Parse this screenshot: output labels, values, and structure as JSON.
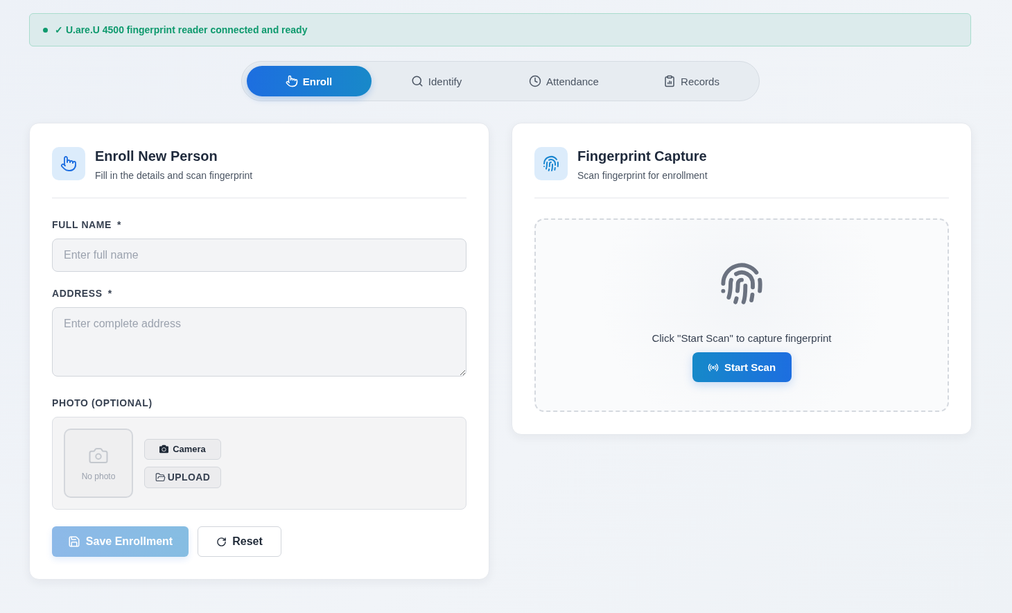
{
  "status_banner": {
    "kind": "success",
    "text": "✓ U.are.U 4500 fingerprint reader connected and ready"
  },
  "tabs": [
    {
      "label": "Enroll",
      "selected": true
    },
    {
      "label": "Identify",
      "selected": false
    },
    {
      "label": "Attendance",
      "selected": false
    },
    {
      "label": "Records",
      "selected": false
    }
  ],
  "enroll_panel": {
    "title": "Enroll New Person",
    "subtitle": "Fill in the details and scan fingerprint",
    "fields": [
      {
        "kind": "input",
        "label": "FULL NAME",
        "required_mark": "*",
        "placeholder": "Enter full name"
      },
      {
        "kind": "textarea",
        "label": "ADDRESS",
        "required_mark": "*",
        "placeholder": "Enter complete address"
      }
    ],
    "photo": {
      "label": "PHOTO (OPTIONAL)",
      "empty_text": "No photo",
      "buttons": [
        "Camera",
        "UPLOAD"
      ]
    },
    "actions": [
      {
        "kind": "primary",
        "label": "Save Enrollment",
        "disabled": true
      },
      {
        "kind": "secondary",
        "label": "Reset",
        "disabled": false
      }
    ]
  },
  "capture_panel": {
    "title": "Fingerprint Capture",
    "subtitle": "Scan fingerprint for enrollment",
    "prompt": "Click \"Start Scan\" to capture fingerprint",
    "button": "Start Scan"
  }
}
